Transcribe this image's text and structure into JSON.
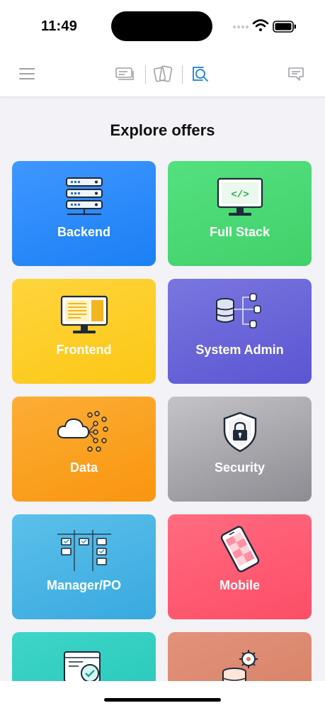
{
  "status_bar": {
    "time": "11:49"
  },
  "page": {
    "title": "Explore offers"
  },
  "offers": [
    {
      "label": "Backend",
      "icon": "server-rack-icon",
      "colors": [
        "#3f97ff",
        "#1b7ff5"
      ]
    },
    {
      "label": "Full Stack",
      "icon": "code-monitor-icon",
      "colors": [
        "#54e07f",
        "#41d16a"
      ]
    },
    {
      "label": "Frontend",
      "icon": "layout-monitor-icon",
      "colors": [
        "#ffd53d",
        "#fcc715"
      ]
    },
    {
      "label": "System Admin",
      "icon": "database-network-icon",
      "colors": [
        "#7a76df",
        "#5b55d2"
      ]
    },
    {
      "label": "Data",
      "icon": "cloud-data-icon",
      "colors": [
        "#fbae35",
        "#fa950f"
      ]
    },
    {
      "label": "Security",
      "icon": "shield-lock-icon",
      "colors": [
        "#c3c3c8",
        "#8c8c92"
      ]
    },
    {
      "label": "Manager/PO",
      "icon": "kanban-board-icon",
      "colors": [
        "#5cc0ea",
        "#38a9e0"
      ]
    },
    {
      "label": "Mobile",
      "icon": "smartphone-icon",
      "colors": [
        "#ff6b80",
        "#fd4d67"
      ]
    },
    {
      "label": "",
      "icon": "code-review-icon",
      "colors": [
        "#3ed5c7",
        "#23c6b8"
      ]
    },
    {
      "label": "",
      "icon": "database-settings-icon",
      "colors": [
        "#e3937a",
        "#d27c63"
      ]
    }
  ]
}
